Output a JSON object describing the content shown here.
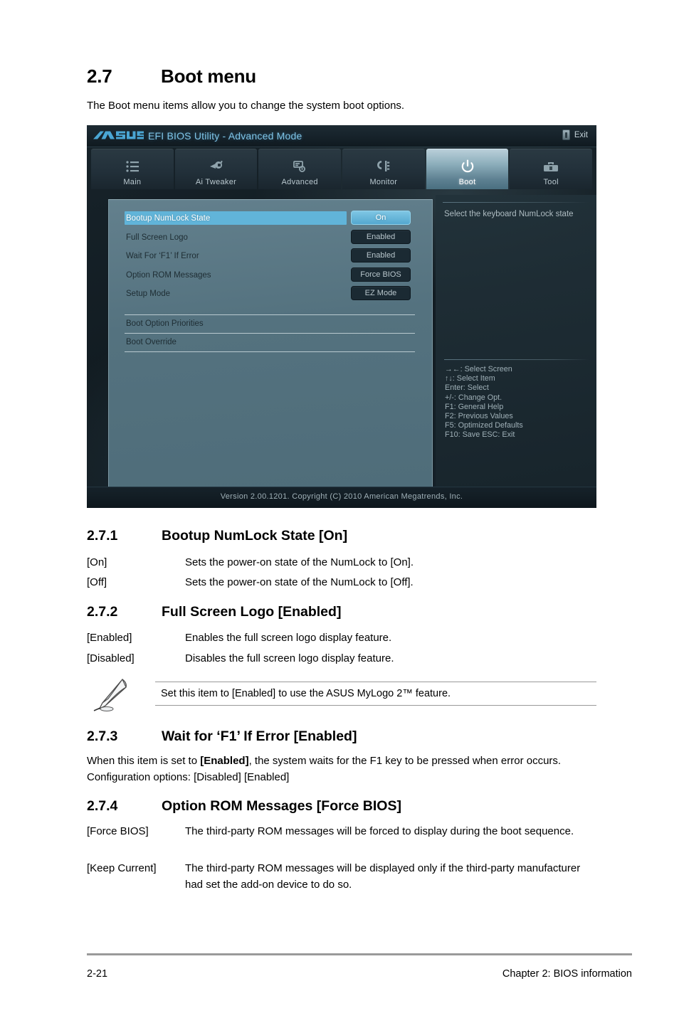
{
  "document": {
    "section": {
      "number": "2.7",
      "title": "Boot menu"
    },
    "intro": "The Boot menu items allow you to change the system boot options.",
    "subsections": [
      {
        "number": "2.7.1",
        "title": "Bootup NumLock State [On]",
        "definitions": [
          {
            "term": "[On]",
            "desc": "Sets the power-on state of the NumLock to [On]."
          },
          {
            "term": "[Off]",
            "desc": "Sets the power-on state of the NumLock to [Off]."
          }
        ]
      },
      {
        "number": "2.7.2",
        "title": "Full Screen Logo [Enabled]",
        "definitions": [
          {
            "term": "[Enabled]",
            "desc": "Enables the full screen logo display feature."
          },
          {
            "term": "[Disabled]",
            "desc": "Disables the full screen logo display feature."
          }
        ],
        "note": "Set this item to [Enabled] to use the ASUS MyLogo 2™ feature."
      },
      {
        "number": "2.7.3",
        "title": "Wait for ‘F1’ If Error [Enabled]",
        "paragraph_pre": "When this item is set to ",
        "paragraph_bold": "[Enabled]",
        "paragraph_post": ", the system waits for the F1 key to be pressed when error occurs. Configuration options: [Disabled] [Enabled]"
      },
      {
        "number": "2.7.4",
        "title": "Option ROM Messages [Force BIOS]",
        "definitions": [
          {
            "term": "[Force BIOS]",
            "desc": "The third-party ROM messages will be forced to display during the boot sequence."
          },
          {
            "term": "[Keep Current]",
            "desc": "The third-party ROM messages will be displayed only if the third-party manufacturer had set the add-on device to do so."
          }
        ]
      }
    ],
    "footer": {
      "page_number": "2-21",
      "chapter": "Chapter 2: BIOS information"
    }
  },
  "bios": {
    "brand": "ASUS",
    "title": "EFI BIOS Utility - Advanced Mode",
    "exit_label": "Exit",
    "tabs": [
      {
        "label": "Main",
        "icon": "list-icon",
        "active": false
      },
      {
        "label": "Ai  Tweaker",
        "icon": "tweak-icon",
        "active": false
      },
      {
        "label": "Advanced",
        "icon": "advanced-icon",
        "active": false
      },
      {
        "label": "Monitor",
        "icon": "monitor-icon",
        "active": false
      },
      {
        "label": "Boot",
        "icon": "power-icon",
        "active": true
      },
      {
        "label": "Tool",
        "icon": "toolbox-icon",
        "active": false
      }
    ],
    "settings": [
      {
        "name": "Bootup NumLock State",
        "value": "On",
        "selected": true
      },
      {
        "name": "Full Screen Logo",
        "value": "Enabled",
        "selected": false
      },
      {
        "name": "Wait For ‘F1’ If Error",
        "value": "Enabled",
        "selected": false
      },
      {
        "name": "Option ROM Messages",
        "value": "Force BIOS",
        "selected": false
      },
      {
        "name": "Setup Mode",
        "value": "EZ Mode",
        "selected": false
      }
    ],
    "submenus": [
      {
        "label": "Boot Option Priorities"
      },
      {
        "label": "Boot Override"
      }
    ],
    "help_text": "Select the keyboard NumLock state",
    "legend": [
      "→←:  Select Screen",
      "↑↓:  Select Item",
      "Enter:  Select",
      "+/-:  Change Opt.",
      "F1:  General Help",
      "F2:  Previous Values",
      "F5:  Optimized Defaults",
      "F10:  Save    ESC:  Exit"
    ],
    "version_text": "Version  2.00.1201.   Copyright  (C)  2010  American  Megatrends,  Inc.",
    "colors": {
      "accent_blue": "#61b4d9",
      "title_blue": "#7fc4e6",
      "panel_left": "#54727f",
      "panel_right": "#22323a"
    }
  }
}
